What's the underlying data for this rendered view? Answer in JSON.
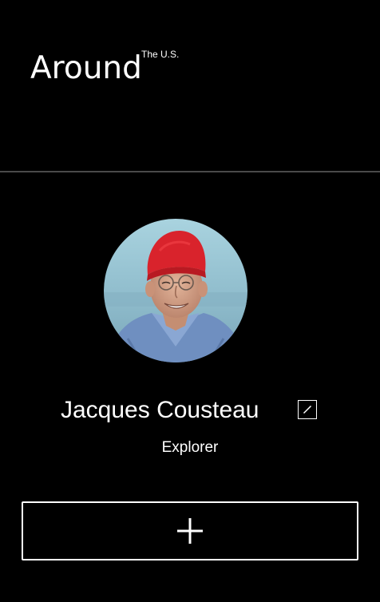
{
  "header": {
    "logo_text": "Around",
    "logo_superscript": "The U.S."
  },
  "profile": {
    "name": "Jacques Cousteau",
    "role": "Explorer",
    "avatar_icon": "avatar-photo",
    "edit_icon": "pencil-icon"
  },
  "actions": {
    "add_icon": "plus-icon"
  },
  "colors": {
    "background": "#000000",
    "foreground": "#ffffff",
    "divider": "#4a4a4a"
  }
}
